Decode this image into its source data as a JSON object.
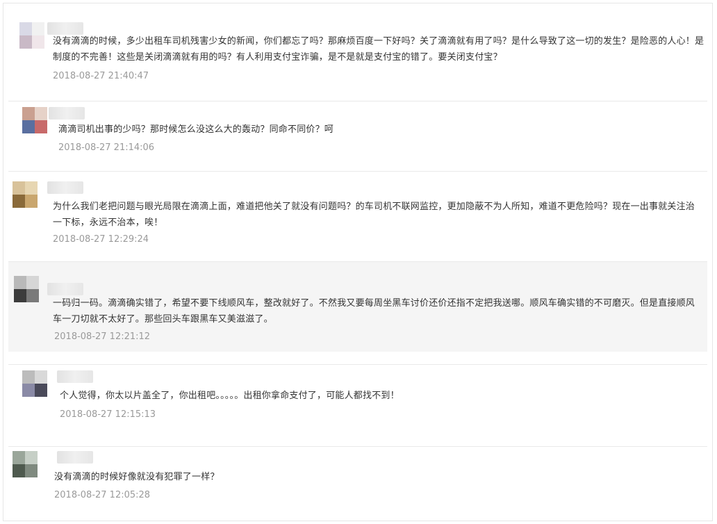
{
  "comments": [
    {
      "text": "没有滴滴的时候，多少出租车司机残害少女的新闻，你们都忘了吗？那麻烦百度一下好吗？关了滴滴就有用了吗？是什么导致了这一切的发生？是险恶的人心！是制度的不完善！这些是关闭滴滴就有用的吗？有人利用支付宝诈骗，是不是就是支付宝的错了。要关闭支付宝？",
      "time": "2018-08-27 21:40:47",
      "colors": [
        "#d9d9e6",
        "#f1f1f1",
        "#c9b9c6",
        "#f0e6ea"
      ]
    },
    {
      "text": "滴滴司机出事的少吗？那时候怎么没这么大的轰动？同命不同价？呵",
      "time": "2018-08-27 21:14:06",
      "colors": [
        "#caa090",
        "#e6d2c8",
        "#5a6fa0",
        "#c86a6a"
      ]
    },
    {
      "text": "为什么我们老把问题与眼光局限在滴滴上面，难道把他关了就没有问题吗？的车司机不联网监控，更加隐蔽不为人所知，难道不更危险吗？现在一出事就关注治一下标，永远不治本，唉！",
      "time": "2018-08-27 12:29:24",
      "colors": [
        "#d8c29a",
        "#e7d6b2",
        "#8a6a3a",
        "#c9a66e"
      ]
    },
    {
      "text": "一码归一码。滴滴确实错了，希望不要下线顺风车，整改就好了。不然我又要每周坐黑车讨价还价还指不定把我送哪。顺风车确实错的不可磨灭。但是直接顺风车一刀切就不太好了。那些回头车跟黑车又美滋滋了。",
      "time": "2018-08-27 12:21:12",
      "colors": [
        "#b9b9b9",
        "#d6d6d6",
        "#3c3c3c",
        "#7a7a7a"
      ]
    },
    {
      "text": "个人觉得，你太以片盖全了，你出租吧。。。。。出租你拿命支付了，可能人都找不到！",
      "time": "2018-08-27 12:15:13",
      "colors": [
        "#bcbcbc",
        "#d9d9d9",
        "#8a8aa6",
        "#4a4a5a"
      ]
    },
    {
      "text": "没有滴滴的时候好像就没有犯罪了一样？",
      "time": "2018-08-27 12:05:28",
      "colors": [
        "#9aa69a",
        "#c6cfc6",
        "#4e5a4e",
        "#7f8a7f"
      ]
    }
  ]
}
